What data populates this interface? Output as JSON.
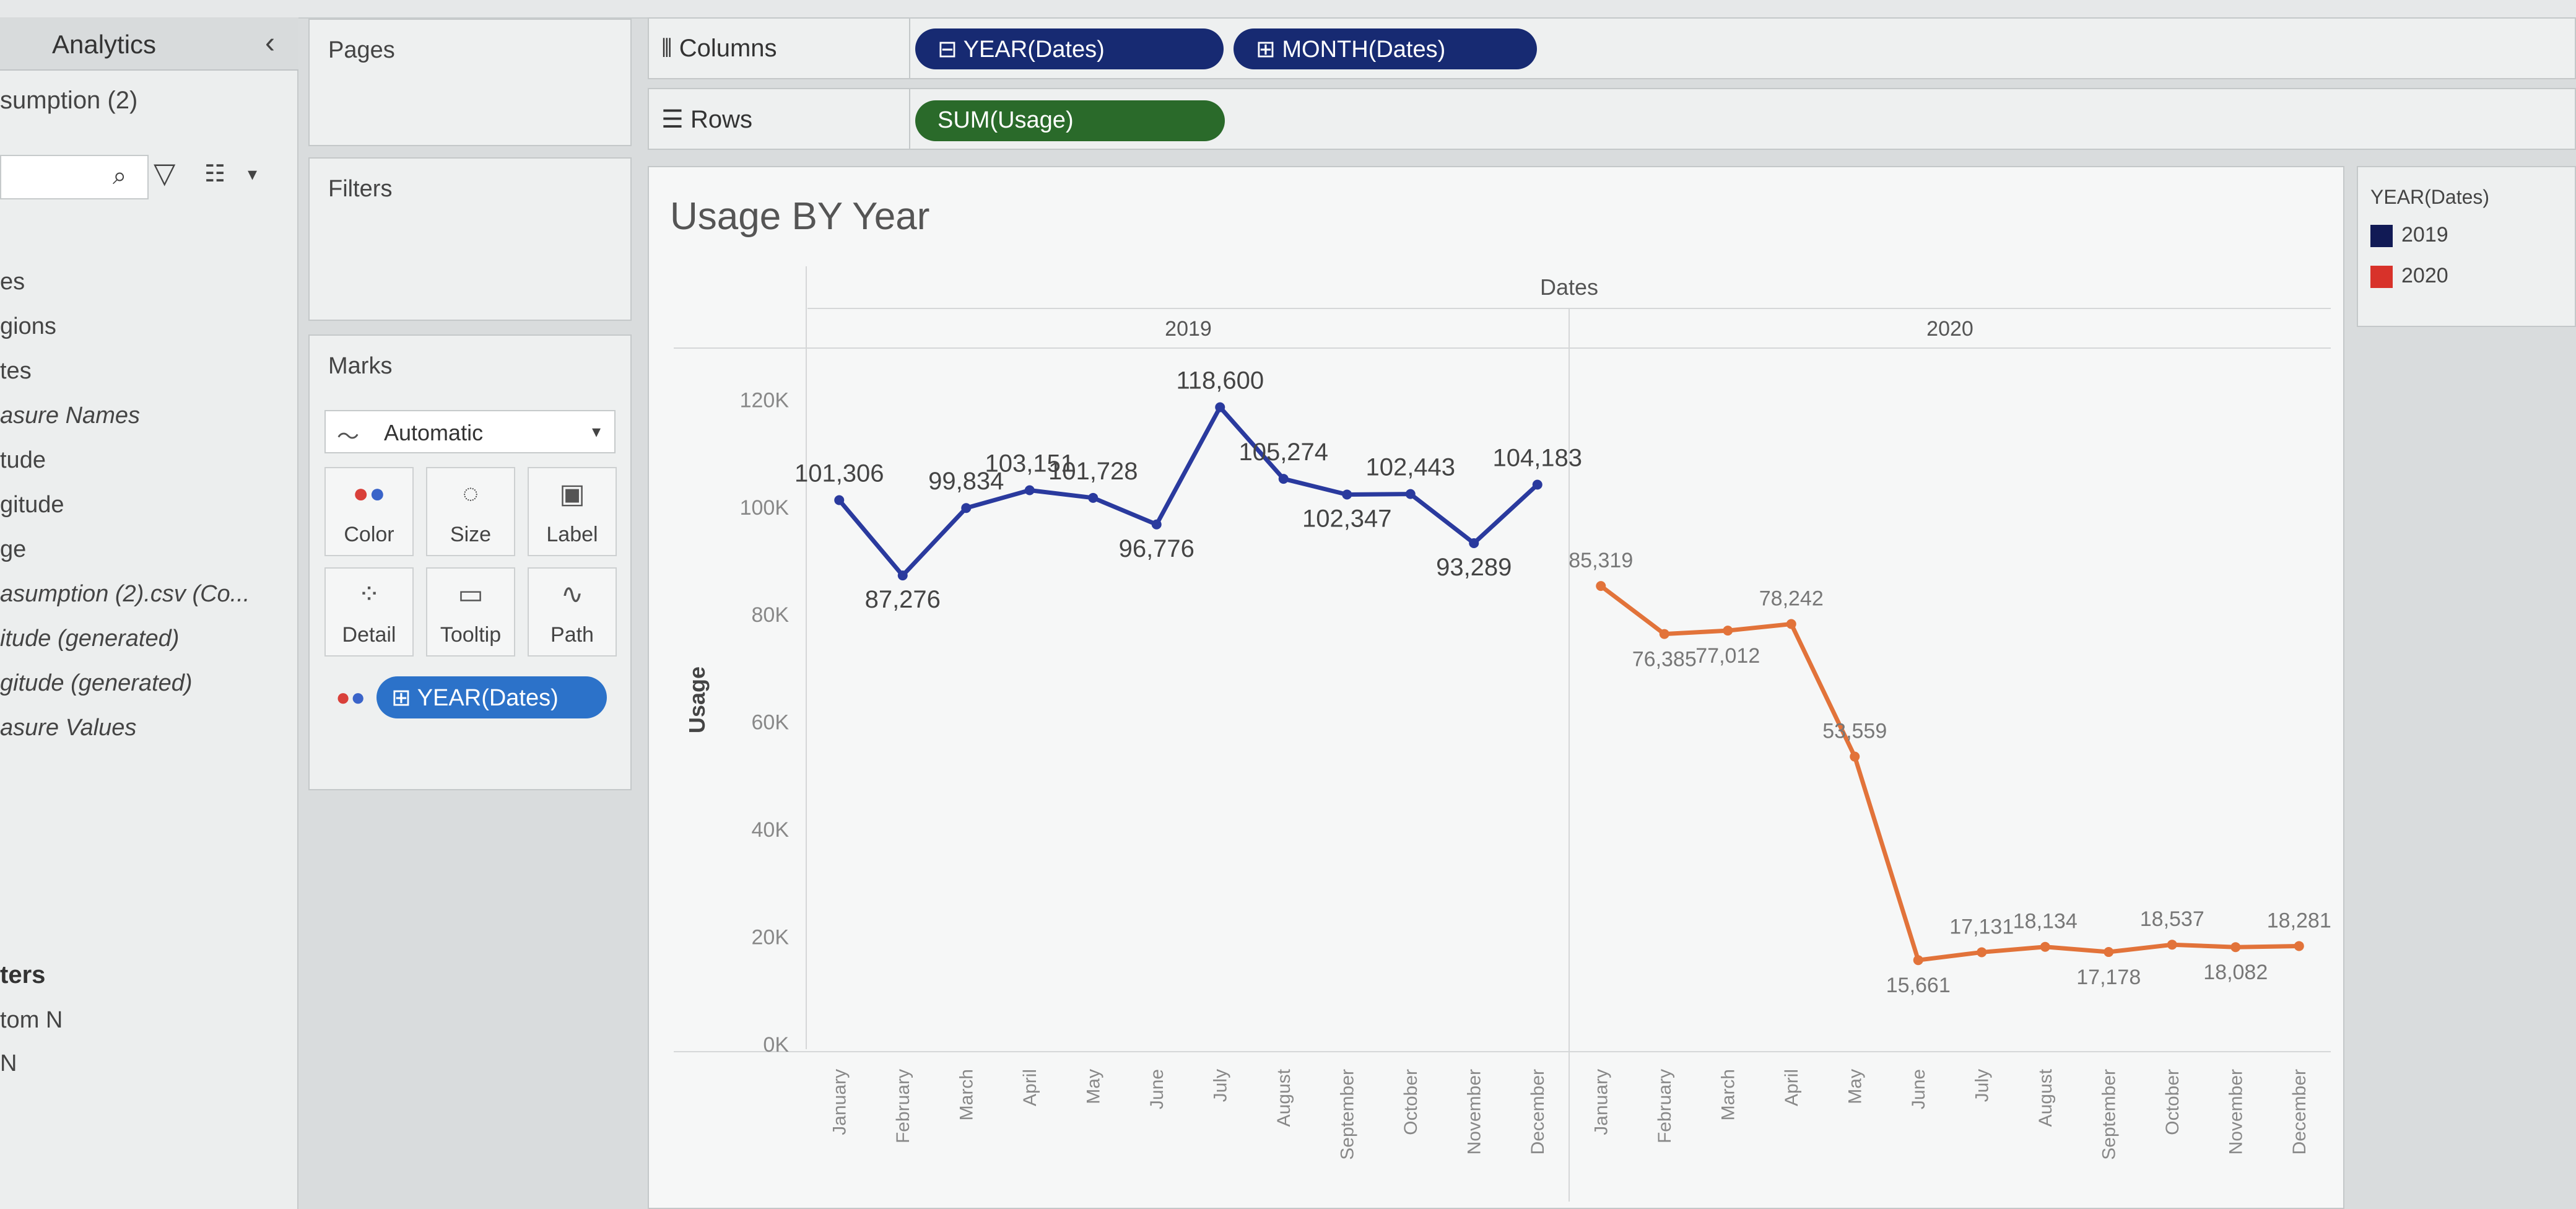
{
  "data_pane": {
    "tab_label": "Analytics",
    "collapse_icon": "chevron-left-icon",
    "datasource": "sumption (2)",
    "search_icon": "search-icon",
    "fields": [
      {
        "label": "es",
        "italic": false
      },
      {
        "label": "gions",
        "italic": false
      },
      {
        "label": "tes",
        "italic": false
      },
      {
        "label": "asure Names",
        "italic": true
      },
      {
        "label": "tude",
        "italic": false
      },
      {
        "label": "gitude",
        "italic": false
      },
      {
        "label": "ge",
        "italic": false
      },
      {
        "label": "asumption (2).csv (Co...",
        "italic": true
      },
      {
        "label": "itude (generated)",
        "italic": true
      },
      {
        "label": "gitude (generated)",
        "italic": true
      },
      {
        "label": "asure Values",
        "italic": true
      }
    ],
    "params_title": "ters",
    "params": [
      "tom N",
      "N"
    ]
  },
  "cards": {
    "pages": "Pages",
    "filters": "Filters",
    "marks": "Marks",
    "mark_type": "Automatic",
    "mark_buttons": [
      {
        "label": "Color",
        "icon": "color-dots-icon"
      },
      {
        "label": "Size",
        "icon": "size-icon"
      },
      {
        "label": "Label",
        "icon": "label-icon"
      },
      {
        "label": "Detail",
        "icon": "detail-icon"
      },
      {
        "label": "Tooltip",
        "icon": "tooltip-icon"
      },
      {
        "label": "Path",
        "icon": "path-icon"
      }
    ],
    "marks_pill": "⊞ YEAR(Dates)"
  },
  "shelves": {
    "columns_label": "Columns",
    "rows_label": "Rows",
    "column_pills": [
      "⊟ YEAR(Dates)",
      "⊞ MONTH(Dates)"
    ],
    "row_pills": [
      "SUM(Usage)"
    ]
  },
  "colors": {
    "pill_dimension": "#172a72",
    "pill_measure": "#2a6a2a",
    "line_2019": "#2a3a9e",
    "line_2020": "#e2733a",
    "legend_2019": "#111a55",
    "legend_2020": "#d8322a"
  },
  "legend": {
    "title": "YEAR(Dates)",
    "items": [
      {
        "label": "2019",
        "color": "#111a55"
      },
      {
        "label": "2020",
        "color": "#d8322a"
      }
    ]
  },
  "viz": {
    "title": "Usage BY Year"
  },
  "chart_data": {
    "type": "line",
    "title": "Usage BY Year",
    "header": "Dates",
    "ylabel": "Usage",
    "ylim": [
      0,
      125000
    ],
    "yticks": [
      "0K",
      "20K",
      "40K",
      "60K",
      "80K",
      "100K",
      "120K"
    ],
    "ytick_values": [
      0,
      20000,
      40000,
      60000,
      80000,
      100000,
      120000
    ],
    "months": [
      "January",
      "February",
      "March",
      "April",
      "May",
      "June",
      "July",
      "August",
      "September",
      "October",
      "November",
      "December"
    ],
    "series": [
      {
        "name": "2019",
        "values": [
          101306,
          87276,
          99834,
          103151,
          101728,
          96776,
          118600,
          105274,
          102347,
          102443,
          93289,
          104183
        ],
        "labels": [
          "101,306",
          "87,276",
          "99,834",
          "103,151",
          "101,728",
          "96,776",
          "118,600",
          "105,274",
          "102,347",
          "102,443",
          "93,289",
          "104,183"
        ]
      },
      {
        "name": "2020",
        "values": [
          85319,
          76385,
          77012,
          78242,
          53559,
          15661,
          17131,
          18134,
          17178,
          18537,
          18082,
          18281
        ],
        "labels": [
          "85,319",
          "76,385",
          "77,012",
          "78,242",
          "53,559",
          "15,661",
          "17,131",
          "18,134",
          "17,178",
          "18,537",
          "18,082",
          "18,281"
        ]
      }
    ],
    "grid": false,
    "legend": "right"
  }
}
